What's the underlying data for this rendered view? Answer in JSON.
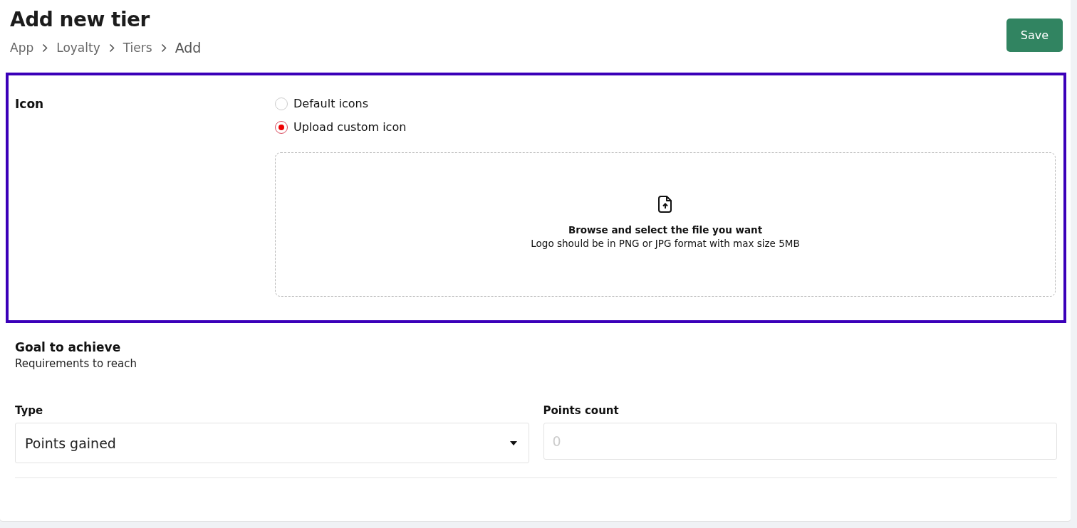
{
  "header": {
    "title": "Add new tier",
    "breadcrumb": [
      "App",
      "Loyalty",
      "Tiers",
      "Add"
    ],
    "save_button": "Save"
  },
  "icon_section": {
    "highlighted": true,
    "label": "Icon",
    "options": [
      {
        "label": "Default icons",
        "selected": false
      },
      {
        "label": "Upload custom icon",
        "selected": true
      }
    ],
    "dropzone": {
      "title": "Browse and select the file you want",
      "hint": "Logo should be in PNG or JPG format with max size 5MB"
    }
  },
  "goal_section": {
    "title": "Goal to achieve",
    "subtitle": "Requirements to reach",
    "fields": [
      {
        "kind": "select",
        "label": "Type",
        "value": "Points gained"
      },
      {
        "kind": "input",
        "label": "Points count",
        "placeholder": "0"
      }
    ]
  }
}
